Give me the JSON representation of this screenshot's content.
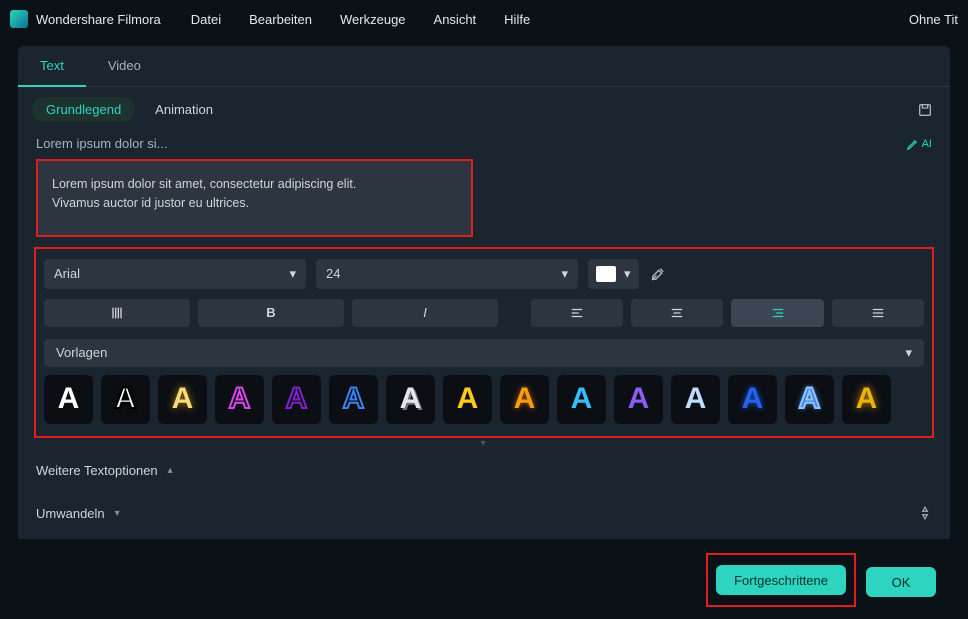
{
  "app": {
    "title": "Wondershare Filmora",
    "doc": "Ohne Tit"
  },
  "menu": [
    "Datei",
    "Bearbeiten",
    "Werkzeuge",
    "Ansicht",
    "Hilfe"
  ],
  "tabs": {
    "text": "Text",
    "video": "Video"
  },
  "subtabs": {
    "basic": "Grundlegend",
    "anim": "Animation",
    "ai_label": "AI"
  },
  "label_short": "Lorem ipsum dolor si...",
  "textarea": "Lorem ipsum dolor sit amet, consectetur adipiscing elit.\nVivamus auctor id justor eu ultrices.",
  "font": {
    "family": "Arial",
    "size": "24"
  },
  "vorlagen_label": "Vorlagen",
  "expanders": {
    "more": "Weitere Textoptionen",
    "transform": "Umwandeln"
  },
  "footer": {
    "advanced": "Fortgeschrittene",
    "ok": "OK"
  },
  "templates": [
    {
      "fill": "#ffffff",
      "stroke": "none",
      "shadow": "none"
    },
    {
      "fill": "#ffffff",
      "stroke": "#000",
      "shadow": "0 0 4px #000"
    },
    {
      "fill": "#f5d97a",
      "stroke": "none",
      "shadow": "0 0 8px #a87b00"
    },
    {
      "fill": "transparent",
      "stroke": "#d946ef",
      "shadow": "none"
    },
    {
      "fill": "transparent",
      "stroke": "#7e22ce",
      "shadow": "none"
    },
    {
      "fill": "transparent",
      "stroke": "#3b82f6",
      "shadow": "none"
    },
    {
      "fill": "#e5e7eb",
      "stroke": "none",
      "shadow": "2px 2px 0 #6b7280"
    },
    {
      "fill": "#facc15",
      "stroke": "none",
      "shadow": "none"
    },
    {
      "fill": "#f59e0b",
      "stroke": "none",
      "shadow": "0 0 6px #b45309"
    },
    {
      "fill": "#38bdf8",
      "stroke": "none",
      "shadow": "none"
    },
    {
      "fill": "#8b5cf6",
      "stroke": "none",
      "shadow": "none"
    },
    {
      "fill": "#bfdbfe",
      "stroke": "none",
      "shadow": "none"
    },
    {
      "fill": "#2563eb",
      "stroke": "none",
      "shadow": "0 0 6px #1d4ed8"
    },
    {
      "fill": "#3b82f6",
      "stroke": "#93c5fd",
      "shadow": "0 0 6px #60a5fa"
    },
    {
      "fill": "#eab308",
      "stroke": "none",
      "shadow": "0 0 8px #ca8a04"
    }
  ]
}
